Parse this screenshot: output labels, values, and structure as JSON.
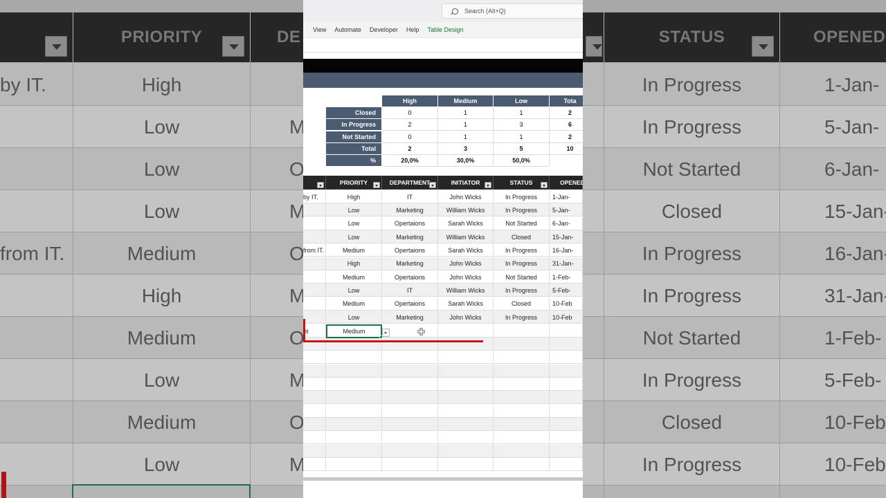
{
  "ribbon": {
    "search_placeholder": "Search (Alt+Q)",
    "menu": [
      "View",
      "Automate",
      "Developer",
      "Help",
      "Table Design"
    ],
    "active_menu_index": 4
  },
  "summary": {
    "columns": [
      "High",
      "Medium",
      "Low",
      "Tota"
    ],
    "rows": [
      {
        "label": "Closed",
        "values": [
          "0",
          "1",
          "1",
          "2"
        ]
      },
      {
        "label": "In Progress",
        "values": [
          "2",
          "1",
          "3",
          "6"
        ]
      },
      {
        "label": "Not Started",
        "values": [
          "0",
          "1",
          "1",
          "2"
        ]
      },
      {
        "label": "Total",
        "values": [
          "2",
          "3",
          "5",
          "10"
        ]
      },
      {
        "label": "%",
        "values": [
          "20,0%",
          "30,0%",
          "50,0%",
          ""
        ]
      }
    ]
  },
  "table": {
    "headers": [
      "",
      "PRIORITY",
      "DEPARTMENT",
      "INITIATOR",
      "STATUS",
      "OPENED"
    ],
    "rows": [
      [
        "by IT.",
        "High",
        "IT",
        "John Wicks",
        "In Progress",
        "1-Jan-"
      ],
      [
        "",
        "Low",
        "Marketing",
        "William Wicks",
        "In Progress",
        "5-Jan-"
      ],
      [
        "",
        "Low",
        "Opertaions",
        "Sarah  Wicks",
        "Not Started",
        "6-Jan-"
      ],
      [
        "",
        "Low",
        "Marketing",
        "William Wicks",
        "Closed",
        "15-Jan-"
      ],
      [
        "from IT.",
        "Medium",
        "Opertaions",
        "Sarah  Wicks",
        "In Progress",
        "16-Jan-"
      ],
      [
        "",
        "High",
        "Marketing",
        "John Wicks",
        "In Progress",
        "31-Jan-"
      ],
      [
        "",
        "Medium",
        "Opertaions",
        "John Wicks",
        "Not Started",
        "1-Feb-"
      ],
      [
        "",
        "Low",
        "IT",
        "William Wicks",
        "In Progress",
        "5-Feb-"
      ],
      [
        "",
        "Medium",
        "Opertaions",
        "Sarah  Wicks",
        "Closed",
        "10-Feb"
      ],
      [
        "",
        "Low",
        "Marketing",
        "John Wicks",
        "In Progress",
        "10-Feb"
      ]
    ],
    "active_row": {
      "first": "nt",
      "priority": "Medium"
    }
  },
  "background": {
    "headers": [
      "PRIORITY",
      "DE",
      "STATUS",
      "OPENED"
    ],
    "rows": [
      [
        "by IT.",
        "High",
        "",
        "In Progress",
        "1-Jan-"
      ],
      [
        "",
        "Low",
        "M",
        "In Progress",
        "5-Jan-"
      ],
      [
        "",
        "Low",
        "O",
        "Not Started",
        "6-Jan-"
      ],
      [
        "",
        "Low",
        "M",
        "Closed",
        "15-Jan-"
      ],
      [
        "from IT.",
        "Medium",
        "O",
        "In Progress",
        "16-Jan-"
      ],
      [
        "",
        "High",
        "M",
        "In Progress",
        "31-Jan-"
      ],
      [
        "",
        "Medium",
        "O",
        "Not Started",
        "1-Feb-"
      ],
      [
        "",
        "Low",
        "M",
        "In Progress",
        "5-Feb-"
      ],
      [
        "",
        "Medium",
        "O",
        "Closed",
        "10-Feb-"
      ],
      [
        "",
        "Low",
        "M",
        "In Progress",
        "10-Feb"
      ]
    ]
  },
  "colors": {
    "header_dark": "#262626",
    "summary_navy": "#4a5b72",
    "accent_green": "#1e7145",
    "annotation_red": "#cc1111"
  }
}
